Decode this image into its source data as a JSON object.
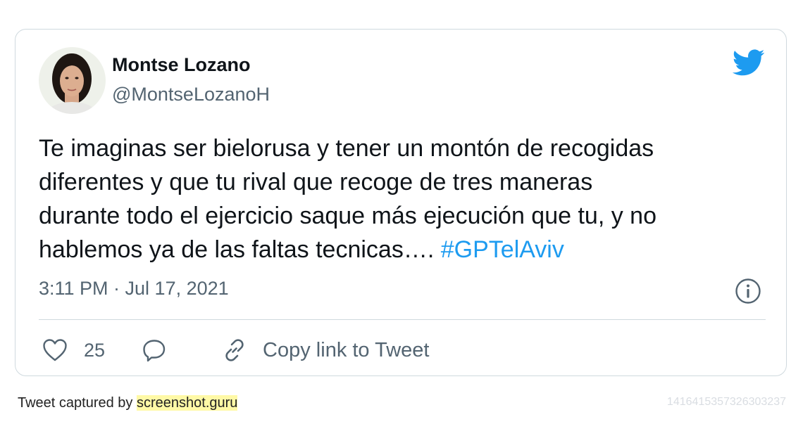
{
  "tweet": {
    "author": {
      "name": "Montse Lozano",
      "handle": "@MontseLozanoH",
      "avatar": "profile-photo"
    },
    "text_lines": [
      "Te imaginas ser bielorusa y tener un montón de recogidas",
      "diferentes y que tu rival que recoge de tres maneras",
      "durante todo el ejercicio saque más ejecución que tu, y no",
      "hablemos ya de las faltas tecnicas…."
    ],
    "hashtag": "#GPTelAviv",
    "timestamp": "3:11 PM · Jul 17, 2021",
    "likes": "25",
    "copy_link_label": "Copy link to Tweet"
  },
  "footer": {
    "captured_by": "Tweet captured by ",
    "site": "screenshot.guru",
    "tweet_id": "1416415357326303237"
  },
  "colors": {
    "brand": "#1d9bf0",
    "text": "#0f1419",
    "muted": "#536471",
    "border": "#cfd9de",
    "highlight": "#fff9a6"
  },
  "icons": [
    "twitter-bird-icon",
    "info-icon",
    "heart-icon",
    "reply-icon",
    "link-icon"
  ]
}
